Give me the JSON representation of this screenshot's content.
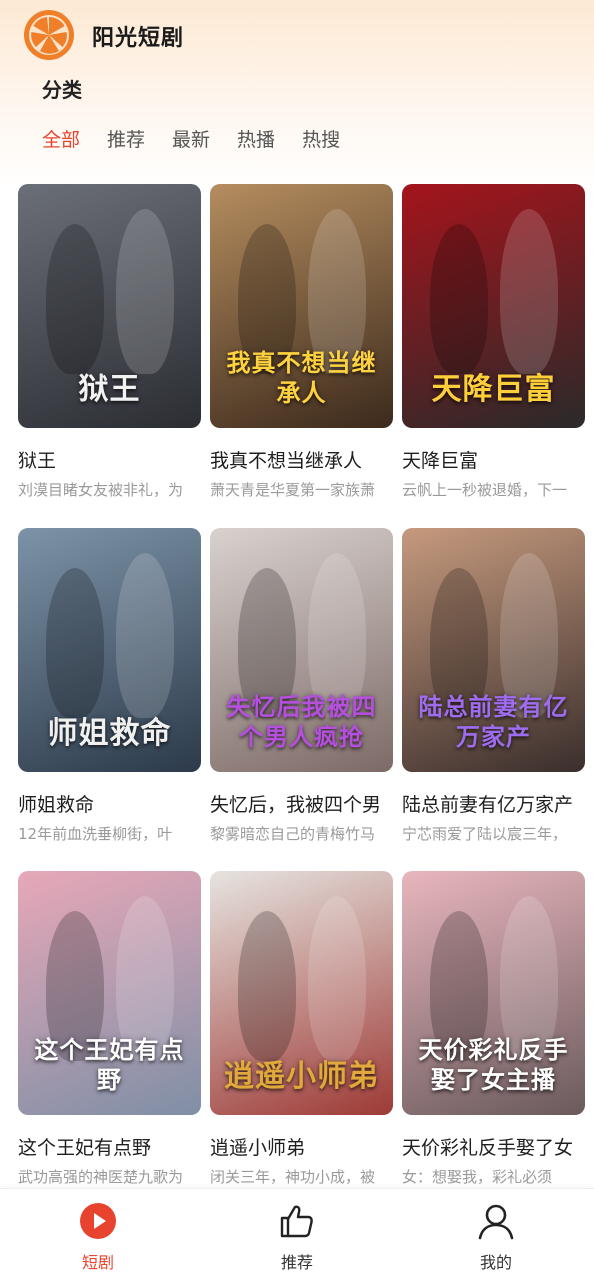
{
  "app": {
    "title": "阳光短剧"
  },
  "section": {
    "title": "分类"
  },
  "tabs": [
    {
      "label": "全部",
      "active": true
    },
    {
      "label": "推荐",
      "active": false
    },
    {
      "label": "最新",
      "active": false
    },
    {
      "label": "热播",
      "active": false
    },
    {
      "label": "热搜",
      "active": false
    }
  ],
  "dramas": [
    {
      "title": "狱王",
      "desc": "刘漠目睹女友被非礼，为",
      "poster_text": "狱王",
      "poster_colors": [
        "#6b6f78",
        "#2b2d33"
      ],
      "text_color": "#f2f2f2"
    },
    {
      "title": "我真不想当继承人",
      "desc": "萧天青是华夏第一家族萧",
      "poster_text": "我真不想当继承人",
      "poster_colors": [
        "#b58d5f",
        "#3c2a1c"
      ],
      "text_color": "#ffd23f"
    },
    {
      "title": "天降巨富",
      "desc": "云帆上一秒被退婚，下一",
      "poster_text": "天降巨富",
      "poster_colors": [
        "#a5141c",
        "#2a2a2a"
      ],
      "text_color": "#ffcf3a"
    },
    {
      "title": "师姐救命",
      "desc": "12年前血洗垂柳街，叶",
      "poster_text": "师姐救命",
      "poster_colors": [
        "#7d93a8",
        "#2c3a4a"
      ],
      "text_color": "#f0f0f0"
    },
    {
      "title": "失忆后，我被四个男",
      "desc": "黎雾暗恋自己的青梅竹马",
      "poster_text": "失忆后我被四个男人疯抢",
      "poster_colors": [
        "#d9d2cf",
        "#7d6a66"
      ],
      "text_color": "#b64fe0"
    },
    {
      "title": "陆总前妻有亿万家产",
      "desc": "宁芯雨爱了陆以宸三年，",
      "poster_text": "陆总前妻有亿万家产",
      "poster_colors": [
        "#c69a7e",
        "#3a2e2c"
      ],
      "text_color": "#9f6cf0"
    },
    {
      "title": "这个王妃有点野",
      "desc": "武功高强的神医楚九歌为",
      "poster_text": "这个王妃有点野",
      "poster_colors": [
        "#e7a8b8",
        "#7f8fa6"
      ],
      "text_color": "#ffffff"
    },
    {
      "title": "逍遥小师弟",
      "desc": "闭关三年，神功小成，被",
      "poster_text": "逍遥小师弟",
      "poster_colors": [
        "#e6e4e0",
        "#9e3a36"
      ],
      "text_color": "#e0a93a"
    },
    {
      "title": "天价彩礼反手娶了女",
      "desc": "女：想娶我，彩礼必须",
      "poster_text": "天价彩礼反手娶了女主播",
      "poster_colors": [
        "#e8b6bd",
        "#6a5a5c"
      ],
      "text_color": "#ffffff"
    }
  ],
  "bottom_nav": [
    {
      "label": "短剧",
      "icon": "play-circle-icon",
      "active": true
    },
    {
      "label": "推荐",
      "icon": "thumbs-up-icon",
      "active": false
    },
    {
      "label": "我的",
      "icon": "user-icon",
      "active": false
    }
  ],
  "colors": {
    "accent": "#e8432e",
    "logo": "#f07f2a"
  }
}
